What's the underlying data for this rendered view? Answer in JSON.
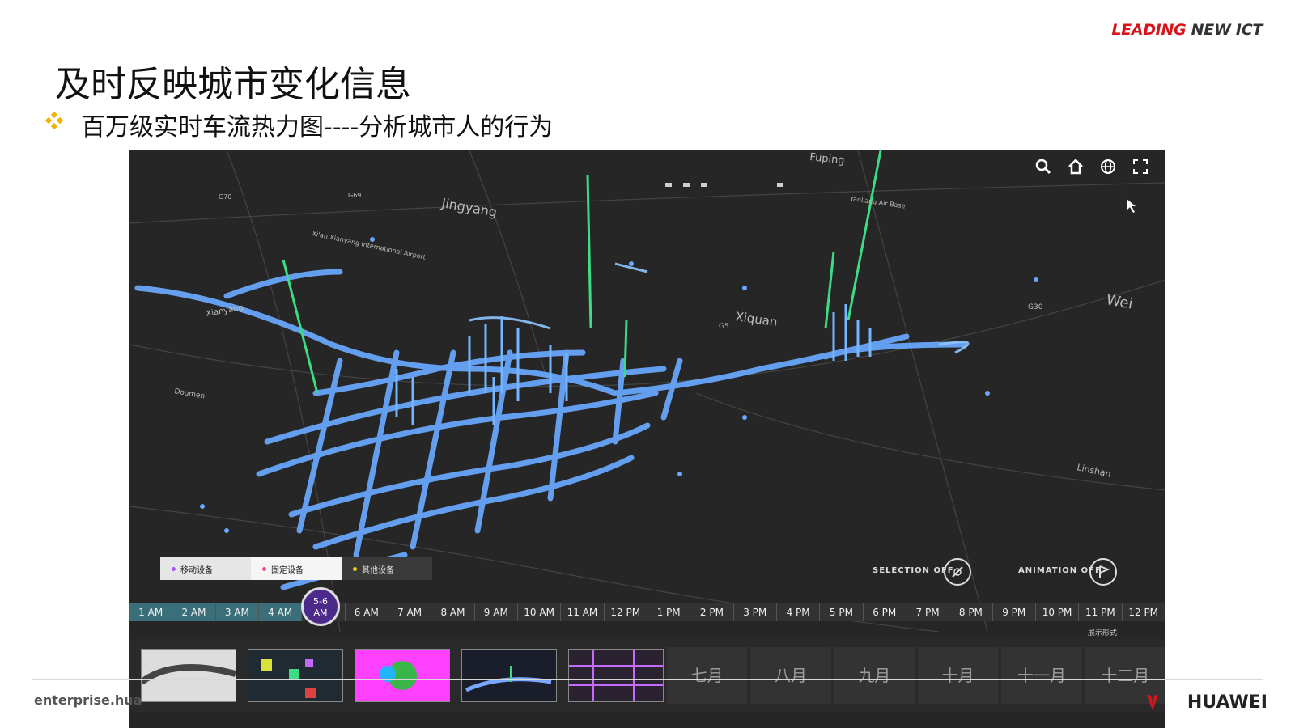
{
  "header": {
    "brand_red": "LEADING",
    "brand_dark": "NEW ICT"
  },
  "title": "及时反映城市变化信息",
  "subtitle": "百万级实时车流热力图----分析城市人的行为",
  "map_labels": {
    "fuping": "Fuping",
    "jingyang": "Jingyang",
    "airport": "Xi'an Xianyang International Airport",
    "airbase": "Yanliang Air Base",
    "xiquan": "Xiquan",
    "xianyang": "Xianyang",
    "doumen": "Doumen",
    "lintong": "Linshan",
    "wei": "Wei",
    "g5": "G5",
    "g30": "G30",
    "g69": "G69",
    "g70": "G70"
  },
  "toolbar": {
    "icons": [
      "search-icon",
      "home-icon",
      "globe-icon",
      "fullscreen-icon"
    ]
  },
  "legend": [
    {
      "label": "移动设备",
      "color": "#a855f7"
    },
    {
      "label": "固定设备",
      "color": "#ec4899"
    },
    {
      "label": "其他设备",
      "color": "#facc15"
    }
  ],
  "selection_label": "SELECTION OFF",
  "animation_label": "ANIMATION OFF",
  "timeline": {
    "hours": [
      "1 AM",
      "2 AM",
      "3 AM",
      "4 AM",
      "",
      "6 AM",
      "7 AM",
      "8 AM",
      "9 AM",
      "10 AM",
      "11 AM",
      "12 PM",
      "1 PM",
      "2 PM",
      "3 PM",
      "4 PM",
      "5 PM",
      "6 PM",
      "7 PM",
      "8 PM",
      "9 PM",
      "10 PM",
      "11 PM",
      "12 PM"
    ],
    "current": "5-6",
    "current_sub": "AM"
  },
  "display_mode": "展示形式",
  "months": [
    "七月",
    "八月",
    "九月",
    "十月",
    "十一月",
    "十二月"
  ],
  "footer": {
    "url": "enterprise.hua",
    "logo_text": "HUAWEI"
  },
  "colors": {
    "accent": "#d7141a",
    "heat": "#6aa9ff",
    "spike": "#3ddc84",
    "bullet": "#f2b400"
  }
}
